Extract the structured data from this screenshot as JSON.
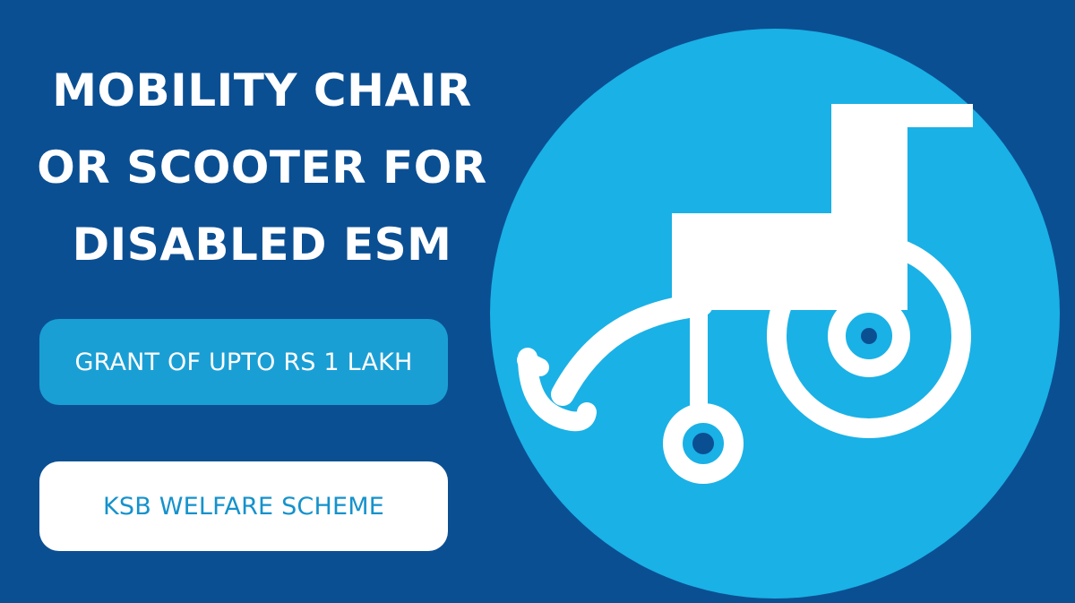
{
  "title": {
    "lines": [
      "MOBILITY CHAIR",
      "OR SCOOTER FOR",
      "DISABLED ESM"
    ]
  },
  "badges": {
    "grant": "GRANT OF UPTO RS 1 LAKH",
    "scheme": "KSB WELFARE SCHEME"
  },
  "icon": {
    "name": "wheelchair-icon"
  },
  "colors": {
    "background": "#0b4f93",
    "circle": "#1ab1e6",
    "grant_pill": "#1a9fd5",
    "scheme_text": "#1592cc",
    "white": "#ffffff"
  }
}
